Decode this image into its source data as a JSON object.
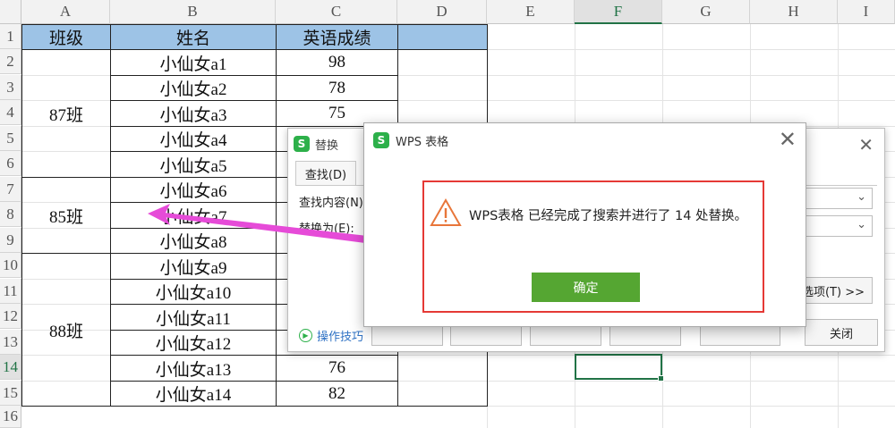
{
  "sheet": {
    "columns": [
      "A",
      "B",
      "C",
      "D",
      "E",
      "F",
      "G",
      "H",
      "I"
    ],
    "active_column": "F",
    "rows": [
      "1",
      "2",
      "3",
      "4",
      "5",
      "6",
      "7",
      "8",
      "9",
      "10",
      "11",
      "12",
      "13",
      "14",
      "15",
      "16"
    ],
    "active_row": "14",
    "headers": {
      "class": "班级",
      "name": "姓名",
      "score": "英语成绩"
    },
    "groups": [
      "87班",
      "85班",
      "88班"
    ],
    "names": [
      "小仙女a1",
      "小仙女a2",
      "小仙女a3",
      "小仙女a4",
      "小仙女a5",
      "小仙女a6",
      "小仙女a7",
      "小仙女a8",
      "小仙女a9",
      "小仙女a10",
      "小仙女a11",
      "小仙女a12",
      "小仙女a13",
      "小仙女a14"
    ],
    "scores": [
      "98",
      "78",
      "75",
      "",
      "",
      "",
      "",
      "",
      "",
      "",
      "",
      "",
      "76",
      "82"
    ]
  },
  "replace_dialog": {
    "title": "替换",
    "tab_find": "查找(D)",
    "find_label": "查找内容(N)",
    "replace_label": "替换为(E):",
    "options_button": "选项(T) >>",
    "tips_link": "操作技巧",
    "close_button": "关闭"
  },
  "message_dialog": {
    "logo": "S",
    "title": "WPS 表格",
    "message": "WPS表格 已经完成了搜索并进行了 14 处替换。",
    "ok_button": "确定"
  },
  "colors": {
    "header_fill": "#9dc3e6",
    "ok_button": "#55a632",
    "highlight": "#e53935",
    "arrow": "#e64bd8",
    "selection": "#217346"
  }
}
